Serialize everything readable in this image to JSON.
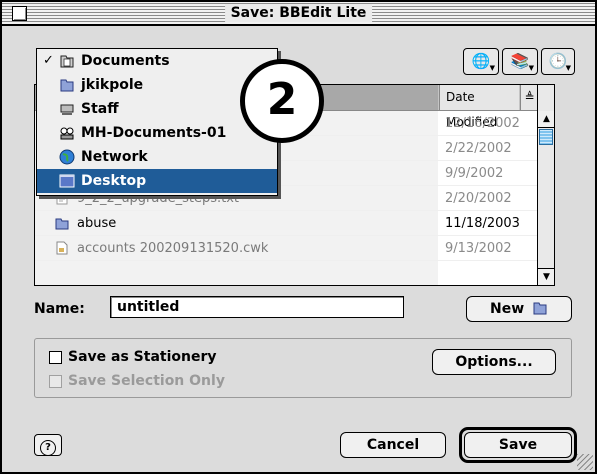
{
  "window": {
    "title": "Save: BBEdit Lite"
  },
  "annotation": {
    "number": "2"
  },
  "nav_buttons": [
    {
      "name": "shortcuts-icon",
      "glyph": "🌐"
    },
    {
      "name": "favorites-icon",
      "glyph": "📚"
    },
    {
      "name": "recent-icon",
      "glyph": "🕒"
    }
  ],
  "location_menu": {
    "items": [
      {
        "label": "Documents",
        "checked": true,
        "selected": false,
        "icon": "documents-folder-icon"
      },
      {
        "label": "jkikpole",
        "checked": false,
        "selected": false,
        "icon": "home-folder-icon"
      },
      {
        "label": "Staff",
        "checked": false,
        "selected": false,
        "icon": "hard-drive-icon"
      },
      {
        "label": "MH-Documents-01",
        "checked": false,
        "selected": false,
        "icon": "network-volume-icon"
      },
      {
        "label": "Network",
        "checked": false,
        "selected": false,
        "icon": "network-globe-icon"
      },
      {
        "label": "Desktop",
        "checked": false,
        "selected": true,
        "icon": "desktop-icon"
      }
    ]
  },
  "file_list": {
    "date_header": "Date Modified",
    "sort_glyph": "≜",
    "rows": [
      {
        "name": "",
        "date": "12/16/2002",
        "dim": false,
        "dark": false
      },
      {
        "name": "",
        "date": "2/22/2002",
        "dim": false,
        "dark": false
      },
      {
        "name": "",
        "date": "9/9/2002",
        "dim": false,
        "dark": false
      },
      {
        "name": "9_2_2_upgrade_steps.txt",
        "date": "2/20/2002",
        "dim": true,
        "dark": false
      },
      {
        "name": "abuse",
        "date": "11/18/2003",
        "dim": false,
        "dark": true
      },
      {
        "name": "accounts 200209131520.cwk",
        "date": "9/13/2002",
        "dim": true,
        "dark": false
      }
    ]
  },
  "name_field": {
    "label": "Name:",
    "value": "untitled"
  },
  "buttons": {
    "new": "New",
    "options": "Options...",
    "cancel": "Cancel",
    "save": "Save"
  },
  "checkboxes": {
    "stationery": "Save as Stationery",
    "selection_only": "Save Selection Only"
  },
  "colors": {
    "selection": "#1f5c98",
    "scroll_thumb": "#7fc3ee"
  }
}
